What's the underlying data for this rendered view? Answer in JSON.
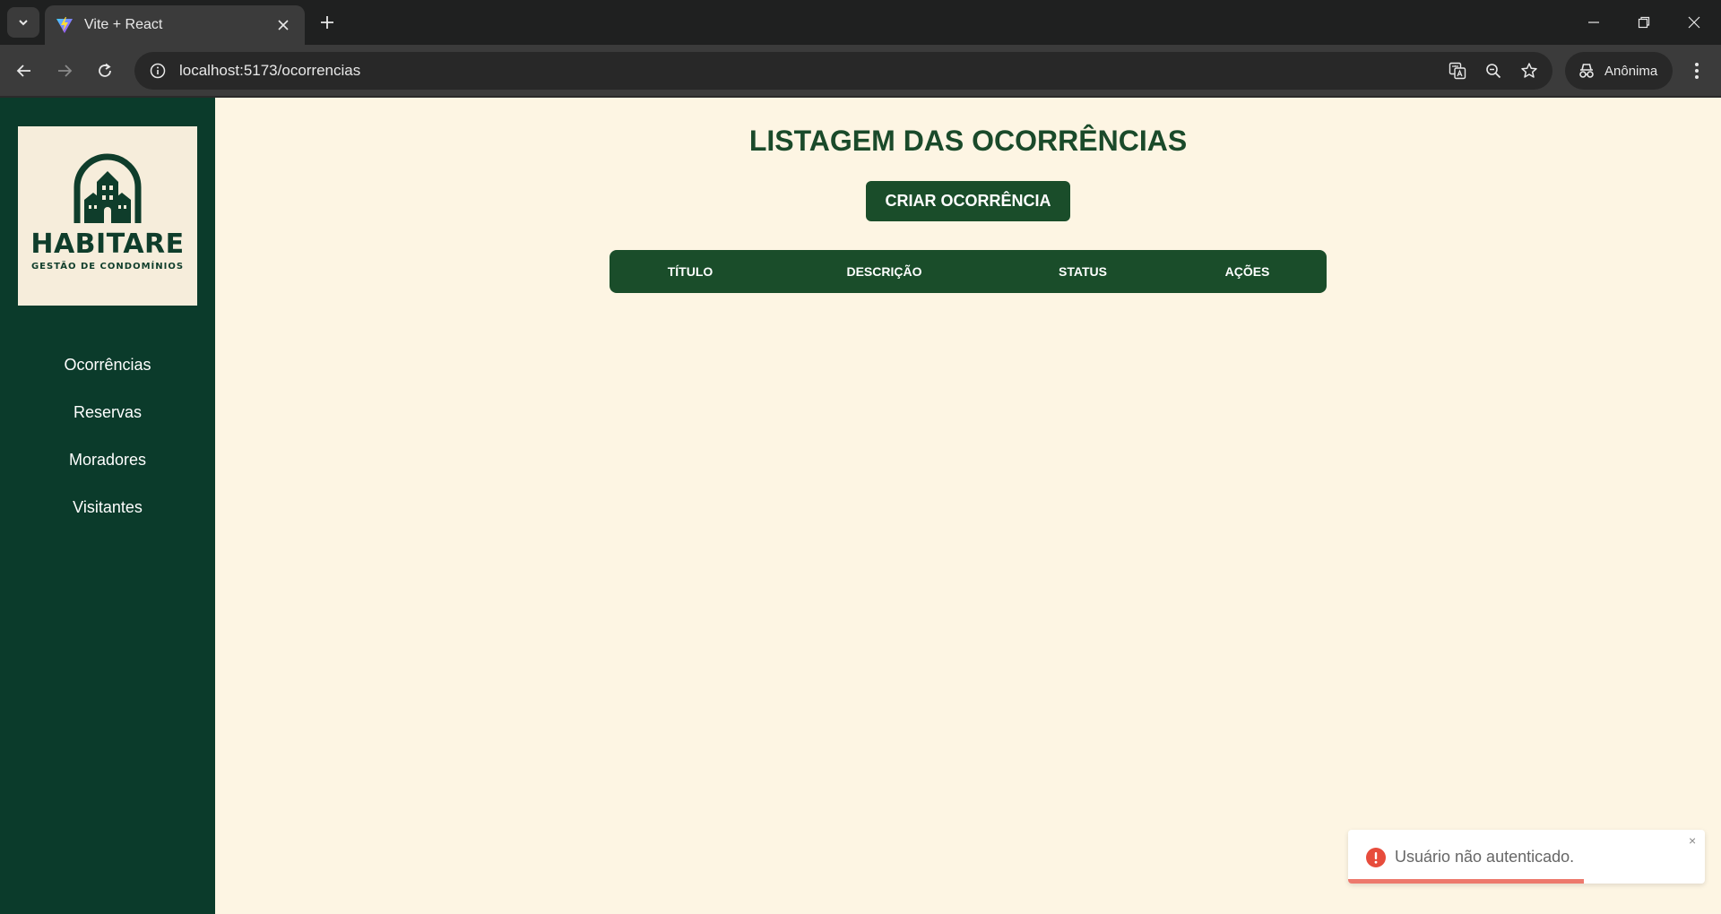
{
  "browser": {
    "tab_title": "Vite + React",
    "url": "localhost:5173/ocorrencias",
    "profile_label": "Anônima"
  },
  "sidebar": {
    "logo_name": "HABITARE",
    "logo_subtitle": "GESTÃO DE CONDOMÍNIOS",
    "items": [
      {
        "label": "Ocorrências"
      },
      {
        "label": "Reservas"
      },
      {
        "label": "Moradores"
      },
      {
        "label": "Visitantes"
      }
    ]
  },
  "main": {
    "title": "LISTAGEM DAS OCORRÊNCIAS",
    "create_button": "CRIAR OCORRÊNCIA",
    "table_headers": [
      "TÍTULO",
      "DESCRIÇÃO",
      "STATUS",
      "AÇÕES"
    ]
  },
  "toast": {
    "message": "Usuário não autenticado.",
    "type": "error",
    "icon": "error-icon",
    "close_glyph": "×",
    "progress_remaining": 0.66
  },
  "colors": {
    "sidebar_bg": "#0b3b2b",
    "page_bg": "#fdf5e3",
    "accent": "#1a4d2a",
    "error": "#e74c3c"
  }
}
